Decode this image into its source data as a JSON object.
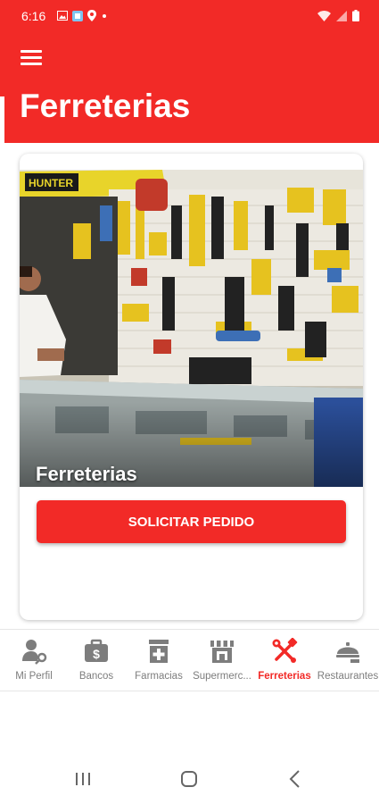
{
  "status_bar": {
    "time": "6:16"
  },
  "header": {
    "title": "Ferreterias"
  },
  "card": {
    "image_caption": "Ferreterias",
    "image_sign_text": "HUNTER",
    "order_button": "SOLICITAR PEDIDO"
  },
  "nav": {
    "items": [
      {
        "label": "Mi Perfil",
        "icon": "user-profile-icon"
      },
      {
        "label": "Bancos",
        "icon": "bank-icon"
      },
      {
        "label": "Farmacias",
        "icon": "pharmacy-icon"
      },
      {
        "label": "Supermerc...",
        "icon": "supermarket-icon"
      },
      {
        "label": "Ferreterias",
        "icon": "tools-icon",
        "active": true
      },
      {
        "label": "Restaurantes",
        "icon": "restaurant-icon"
      }
    ]
  },
  "colors": {
    "accent": "#f22a27",
    "inactive": "#7d7d7d"
  }
}
